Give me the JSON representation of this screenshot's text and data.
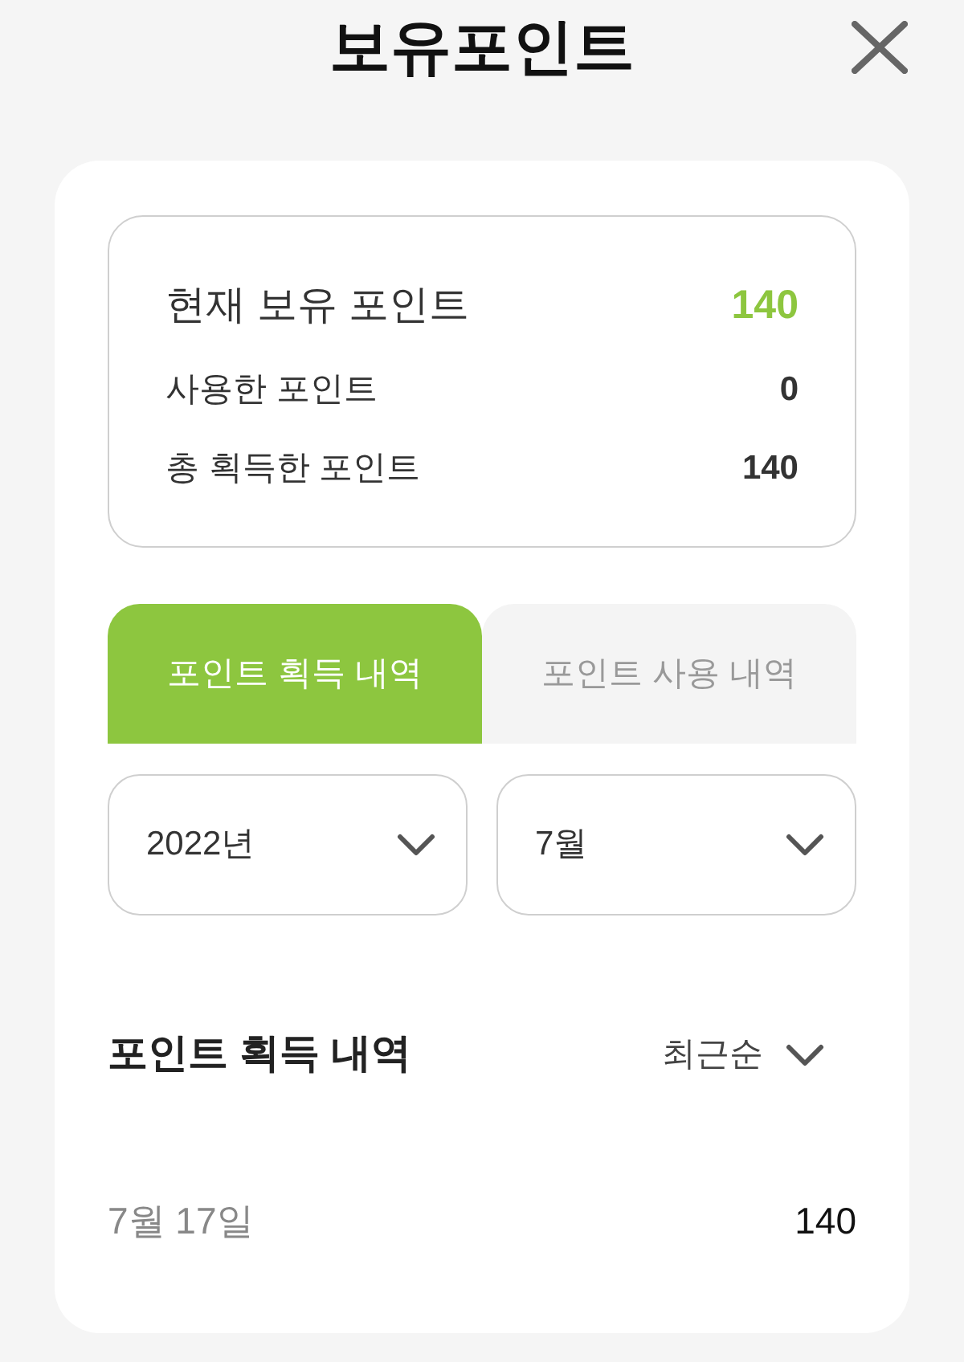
{
  "header": {
    "title": "보유포인트"
  },
  "summary": [
    {
      "kind": "primary",
      "label": "현재 보유 포인트",
      "value": "140"
    },
    {
      "kind": "secondary",
      "label": "사용한 포인트",
      "value": "0"
    },
    {
      "kind": "secondary",
      "label": "총 획득한 포인트",
      "value": "140"
    }
  ],
  "tabs": [
    {
      "label": "포인트 획득 내역",
      "selected": true
    },
    {
      "label": "포인트 사용 내역",
      "selected": false
    }
  ],
  "filters": [
    {
      "value": "2022년"
    },
    {
      "value": "7월"
    }
  ],
  "history": {
    "title": "포인트 획득 내역",
    "sort": "최근순",
    "rows": [
      {
        "date": "7월 17일",
        "points": "140"
      }
    ]
  }
}
